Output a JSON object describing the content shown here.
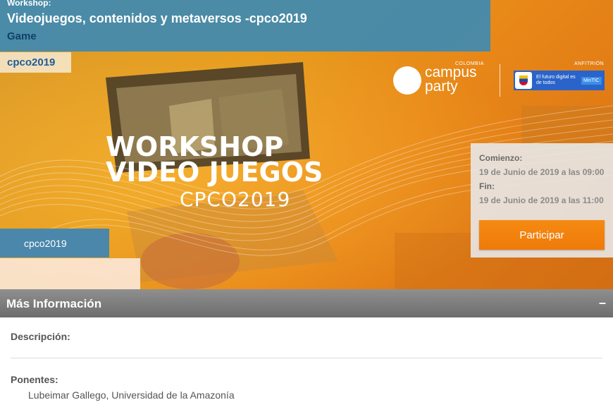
{
  "event": {
    "kicker": "Workshop:",
    "title": "Videojuegos, contenidos y metaversos -cpco2019",
    "category": "Game",
    "tag_top": "cpco2019",
    "tag_bottom": "cpco2019"
  },
  "banner": {
    "headline_line1": "WORKSHOP",
    "headline_line2": "VIDEO JUEGOS",
    "subline": "CPCO2019",
    "logo_small": "COLOMBIA",
    "logo_word1": "campus",
    "logo_word2": "party",
    "host_label": "ANFITRIÓN",
    "host_text": "El futuro digital es de todos",
    "host_badge": "MinTIC"
  },
  "schedule": {
    "start_label": "Comienzo:",
    "start_value": "19 de Junio de 2019 a las 09:00",
    "end_label": "Fin:",
    "end_value": "19 de Junio de 2019 a las 11:00",
    "cta_label": "Participar"
  },
  "details": {
    "section_title": "Más Información",
    "collapse_symbol": "–",
    "description_label": "Descripción:",
    "speakers_label": "Ponentes:",
    "speakers": [
      "Lubeimar Gallego, Universidad de la Amazonía"
    ]
  },
  "colors": {
    "title_bg": "#3e8ab2",
    "accent_orange": "#f58a12",
    "section_bar": "#7a7a7a"
  }
}
